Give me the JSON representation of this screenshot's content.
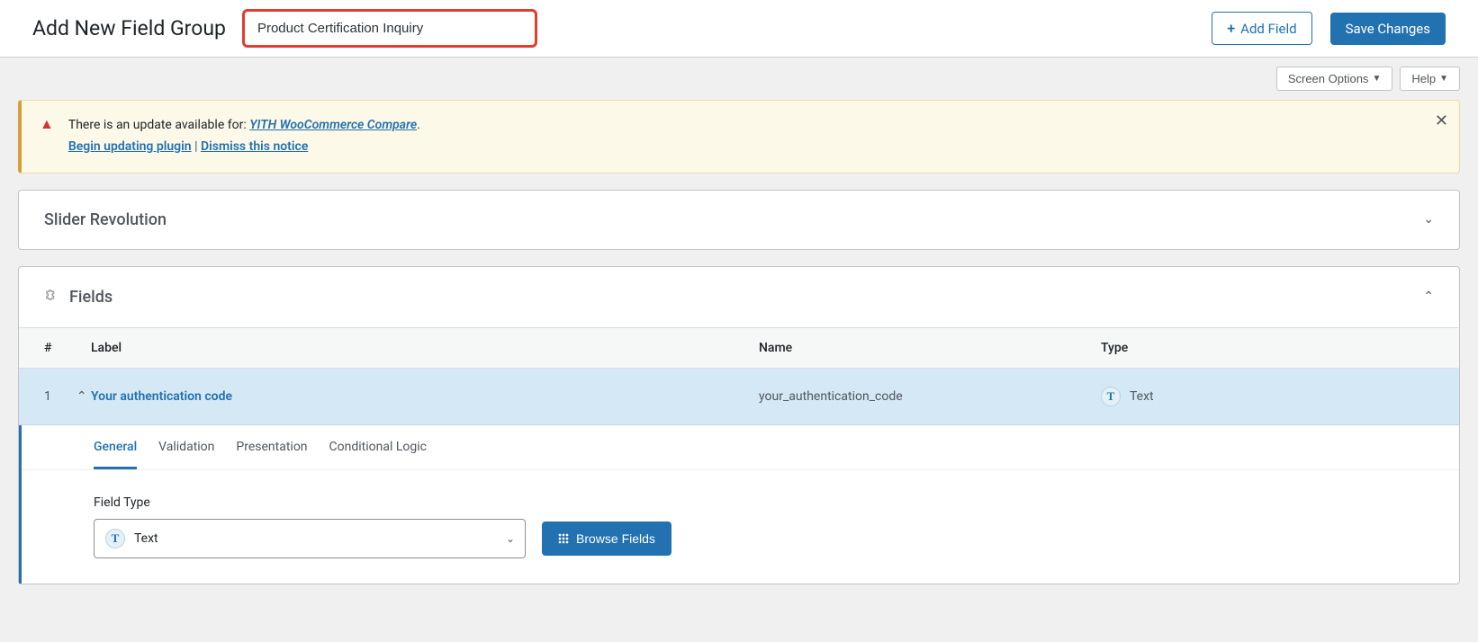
{
  "header": {
    "title": "Add New Field Group",
    "group_name": "Product Certification Inquiry",
    "add_field_label": "Add Field",
    "save_label": "Save Changes"
  },
  "options": {
    "screen_options": "Screen Options",
    "help": "Help"
  },
  "notice": {
    "text_prefix": "There is an update available for: ",
    "plugin_link": "YITH WooCommerce Compare",
    "period": ".",
    "begin_link": "Begin updating plugin",
    "sep": " | ",
    "dismiss_link": "Dismiss this notice"
  },
  "panels": {
    "slider_title": "Slider Revolution",
    "fields_title": "Fields"
  },
  "fields_table": {
    "headers": {
      "num": "#",
      "label": "Label",
      "name": "Name",
      "type": "Type"
    },
    "rows": [
      {
        "num": "1",
        "label": "Your authentication code",
        "name": "your_authentication_code",
        "type": "Text",
        "type_badge": "T"
      }
    ]
  },
  "tabs": {
    "general": "General",
    "validation": "Validation",
    "presentation": "Presentation",
    "conditional": "Conditional Logic"
  },
  "settings": {
    "field_type_label": "Field Type",
    "field_type_value": "Text",
    "field_type_badge": "T",
    "browse_label": "Browse Fields"
  }
}
